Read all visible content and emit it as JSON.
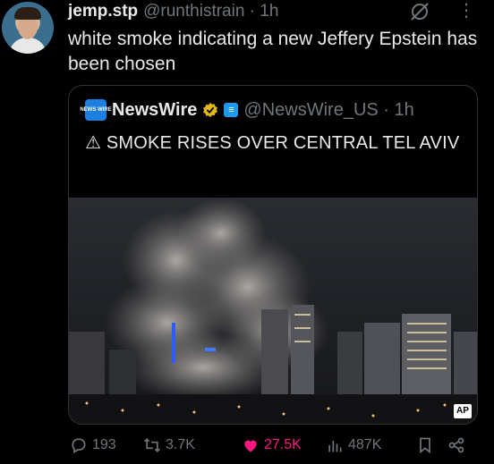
{
  "tweet": {
    "author_name": "jemp.stp",
    "author_handle": "@runthistrain · 1h",
    "text": "white smoke indicating a new Jeffery Epstein has been chosen"
  },
  "quoted": {
    "logo_text": "NEWS WIRE",
    "name": "NewsWire",
    "affiliate_badge": "≡",
    "handle": "@NewsWire_US · 1h",
    "text": "⚠ SMOKE RISES OVER CENTRAL TEL AVIV",
    "photo_credit": "AP"
  },
  "actions": {
    "replies": "193",
    "reposts": "3.7K",
    "likes": "27.5K",
    "views": "487K"
  },
  "colors": {
    "background": "#000000",
    "text": "#e7e9ea",
    "muted": "#71767b",
    "like": "#f91880",
    "border": "#2f3336"
  },
  "icons": [
    "grok-icon",
    "more-icon",
    "verified-badge-icon",
    "reply-icon",
    "repost-icon",
    "like-icon",
    "views-icon",
    "bookmark-icon",
    "share-icon"
  ]
}
